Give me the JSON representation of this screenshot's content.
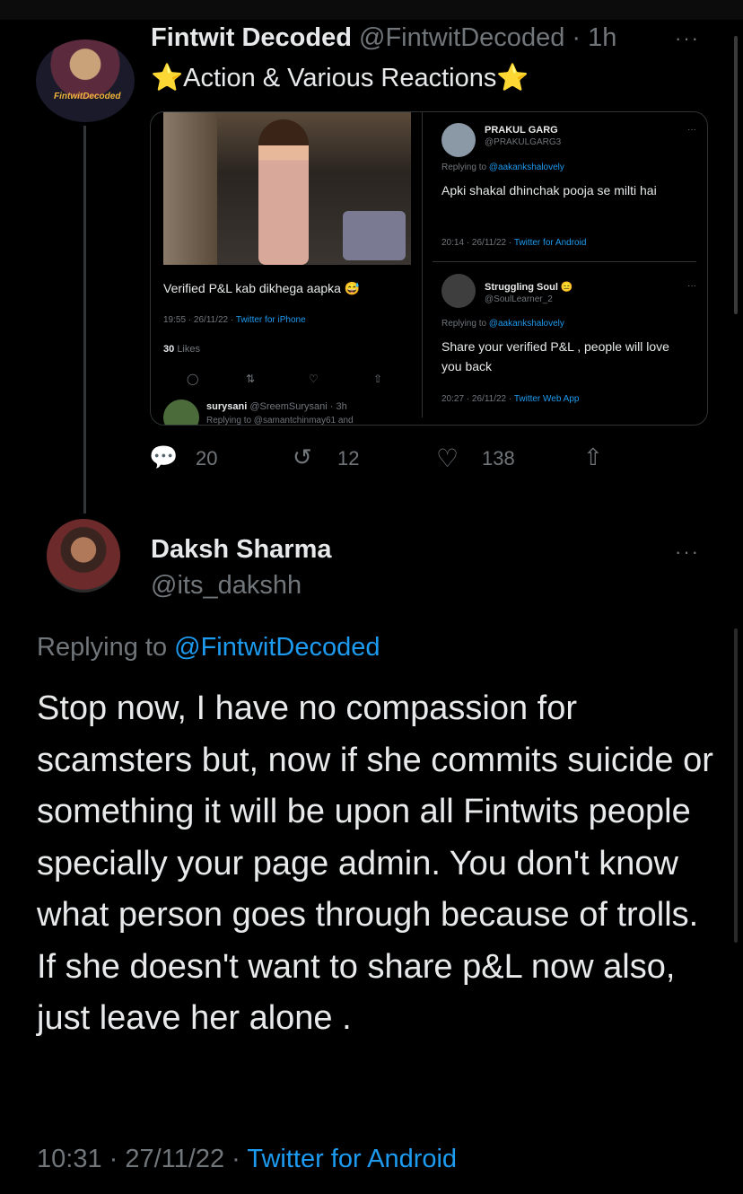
{
  "tweet": {
    "author_name": "Fintwit Decoded",
    "handle": "@FintwitDecoded",
    "dot": "·",
    "time": "1h",
    "title_text": "Action & Various Reactions",
    "star_glyph": "⭐",
    "avatar_brand": "FintwitDecoded",
    "more": "···",
    "stats": {
      "replies": "20",
      "retweets": "12",
      "likes": "138"
    }
  },
  "embed": {
    "left": {
      "caption": "Verified P&L kab dikhega aapka 😅",
      "meta": "19:55 · 26/11/22 ·",
      "source": "Twitter for iPhone",
      "likes_count": "30",
      "likes_label": "Likes",
      "reply_user": "surysani",
      "reply_handle": "@SreemSurysani · 3h",
      "reply_line": "Replying to @samantchinmay61 and"
    },
    "right_top": {
      "name": "PRAKUL GARG",
      "handle": "@PRAKULGARG3",
      "replying_prefix": "Replying to",
      "replying_to": "@aakankshalovely",
      "text": "Apki shakal dhinchak pooja se milti hai",
      "meta": "20:14 · 26/11/22 ·",
      "source": "Twitter for Android",
      "more": "···"
    },
    "right_bottom": {
      "name": "Struggling Soul 😑",
      "handle": "@SoulLearner_2",
      "replying_prefix": "Replying to",
      "replying_to": "@aakankshalovely",
      "text": "Share your verified P&L , people will love you back",
      "meta": "20:27 · 26/11/22 ·",
      "source": "Twitter Web App",
      "more": "···"
    }
  },
  "reply": {
    "author_name": "Daksh Sharma",
    "handle": "@its_dakshh",
    "more": "···",
    "replying_prefix": "Replying to",
    "replying_to": "@FintwitDecoded",
    "text": "Stop now, I have no compassion for scamsters but, now if she commits suicide or something it will be upon all Fintwits people specially your page admin. You don't know what person goes through because of trolls. If she doesn't want to share p&L now also, just leave her alone .",
    "time": "10:31 · 27/11/22 ·",
    "source": "Twitter for Android"
  },
  "colors": {
    "accent": "#1d9bf0",
    "muted": "#71767b",
    "text": "#e7e9ea",
    "background": "#000000"
  },
  "icons": [
    "reply-icon",
    "retweet-icon",
    "like-icon",
    "share-icon",
    "more-icon"
  ]
}
